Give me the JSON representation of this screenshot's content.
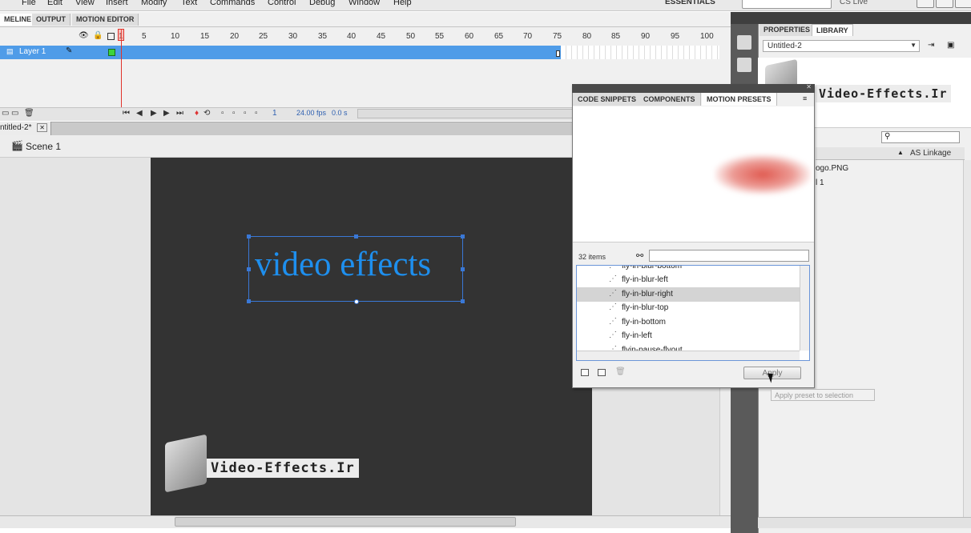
{
  "menu": {
    "items": [
      "File",
      "Edit",
      "View",
      "Insert",
      "Modify",
      "Text",
      "Commands",
      "Control",
      "Debug",
      "Window",
      "Help"
    ],
    "workspace": "ESSENTIALS",
    "cs_live": "CS Live"
  },
  "timeline": {
    "tabs": [
      "MELINE",
      "OUTPUT",
      "MOTION EDITOR"
    ],
    "ruler": [
      "1",
      "5",
      "10",
      "15",
      "20",
      "25",
      "30",
      "35",
      "40",
      "45",
      "50",
      "55",
      "60",
      "65",
      "70",
      "75",
      "80",
      "85",
      "90",
      "95",
      "100"
    ],
    "layer_name": "Layer 1",
    "current_frame": "1",
    "fps": "24.00 fps",
    "elapsed": "0.0 s"
  },
  "document": {
    "tab": "ntitled-2*",
    "scene": "Scene 1",
    "stage_text": "video effects"
  },
  "watermark": {
    "label": "Video-Effects.Ir"
  },
  "right_panel": {
    "tabs": [
      "PROPERTIES",
      "LIBRARY"
    ],
    "document_select": "Untitled-2",
    "column": "AS Linkage",
    "items": [
      "ogo.PNG",
      "l 1"
    ]
  },
  "presets": {
    "tabs": [
      "CODE SNIPPETS",
      "COMPONENTS",
      "MOTION PRESETS"
    ],
    "count": "32 items",
    "items": [
      {
        "label": "fly-in-blur-bottom",
        "selected": false
      },
      {
        "label": "fly-in-blur-left",
        "selected": false
      },
      {
        "label": "fly-in-blur-right",
        "selected": true
      },
      {
        "label": "fly-in-blur-top",
        "selected": false
      },
      {
        "label": "fly-in-bottom",
        "selected": false
      },
      {
        "label": "fly-in-left",
        "selected": false
      },
      {
        "label": "flyin-pause-flyout",
        "selected": false
      }
    ],
    "apply_label": "Apply",
    "tooltip": "Apply preset to selection"
  },
  "colors": {
    "stage": "#333333",
    "selection": "#3a78d6",
    "text": "#1e8fee",
    "layer_highlight": "#4f9ce8"
  }
}
